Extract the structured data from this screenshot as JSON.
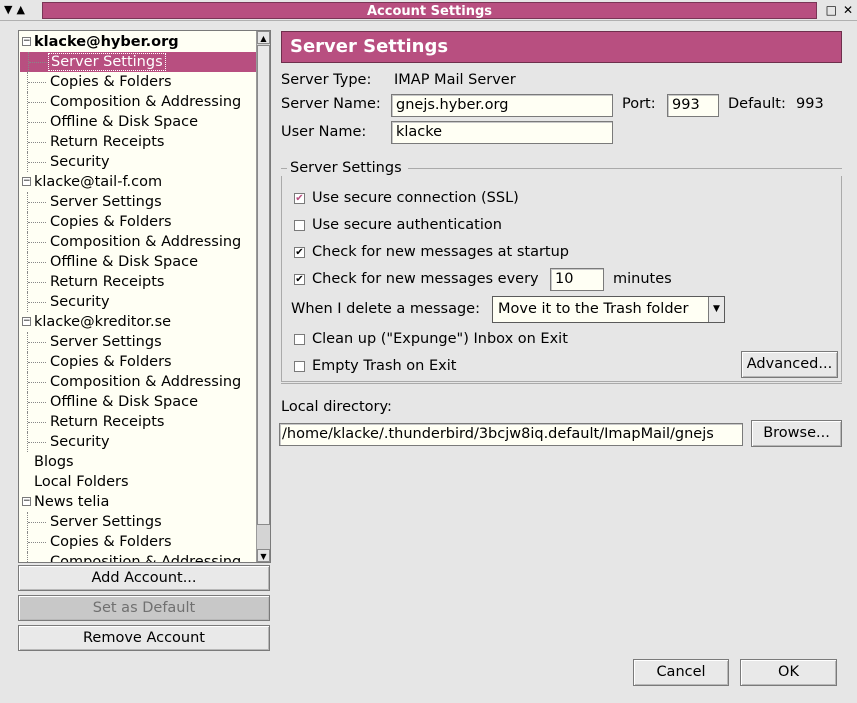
{
  "window": {
    "title": "Account Settings",
    "left_controls": [
      "▼",
      "▲"
    ],
    "right_controls": [
      "□",
      "✕"
    ]
  },
  "tree": {
    "items": [
      {
        "type": "account",
        "label": "klacke@hyber.org",
        "bold": true
      },
      {
        "type": "child",
        "label": "Server Settings",
        "selected": true
      },
      {
        "type": "child",
        "label": "Copies & Folders"
      },
      {
        "type": "child",
        "label": "Composition & Addressing"
      },
      {
        "type": "child",
        "label": "Offline & Disk Space"
      },
      {
        "type": "child",
        "label": "Return Receipts"
      },
      {
        "type": "child",
        "label": "Security"
      },
      {
        "type": "account",
        "label": "klacke@tail-f.com"
      },
      {
        "type": "child",
        "label": "Server Settings"
      },
      {
        "type": "child",
        "label": "Copies & Folders"
      },
      {
        "type": "child",
        "label": "Composition & Addressing"
      },
      {
        "type": "child",
        "label": "Offline & Disk Space"
      },
      {
        "type": "child",
        "label": "Return Receipts"
      },
      {
        "type": "child",
        "label": "Security"
      },
      {
        "type": "account",
        "label": "klacke@kreditor.se"
      },
      {
        "type": "child",
        "label": "Server Settings"
      },
      {
        "type": "child",
        "label": "Copies & Folders"
      },
      {
        "type": "child",
        "label": "Composition & Addressing"
      },
      {
        "type": "child",
        "label": "Offline & Disk Space"
      },
      {
        "type": "child",
        "label": "Return Receipts"
      },
      {
        "type": "child",
        "label": "Security"
      },
      {
        "type": "top",
        "label": "Blogs"
      },
      {
        "type": "top",
        "label": "Local Folders"
      },
      {
        "type": "account",
        "label": "News telia"
      },
      {
        "type": "child",
        "label": "Server Settings"
      },
      {
        "type": "child",
        "label": "Copies & Folders"
      },
      {
        "type": "child",
        "label": "Composition & Addressing"
      }
    ]
  },
  "left_buttons": {
    "add_account": "Add Account...",
    "set_default": "Set as Default",
    "remove_account": "Remove Account"
  },
  "panel": {
    "title": "Server Settings",
    "server_type_label": "Server Type:",
    "server_type_value": "IMAP Mail Server",
    "server_name_label": "Server Name:",
    "server_name_value": "gnejs.hyber.org",
    "port_label": "Port:",
    "port_value": "993",
    "default_label": "Default:",
    "default_value": "993",
    "user_name_label": "User Name:",
    "user_name_value": "klacke",
    "group_title": "Server Settings",
    "ssl_label": "Use secure connection (SSL)",
    "secure_auth_label": "Use secure authentication",
    "check_startup_label": "Check for new messages at startup",
    "check_every_label": "Check for new messages every",
    "check_every_value": "10",
    "minutes_label": "minutes",
    "delete_label": "When I delete a message:",
    "delete_option": "Move it to the Trash folder",
    "expunge_label": "Clean up (\"Expunge\") Inbox on Exit",
    "empty_trash_label": "Empty Trash on Exit",
    "advanced_button": "Advanced...",
    "local_dir_label": "Local directory:",
    "local_dir_value": "/home/klacke/.thunderbird/3bcjw8iq.default/ImapMail/gnejs",
    "browse_button": "Browse..."
  },
  "dialog_buttons": {
    "cancel": "Cancel",
    "ok": "OK"
  },
  "colors": {
    "accent": "#b84f80",
    "tree_bg": "#fffff4",
    "window_bg": "#e6e6e6"
  }
}
